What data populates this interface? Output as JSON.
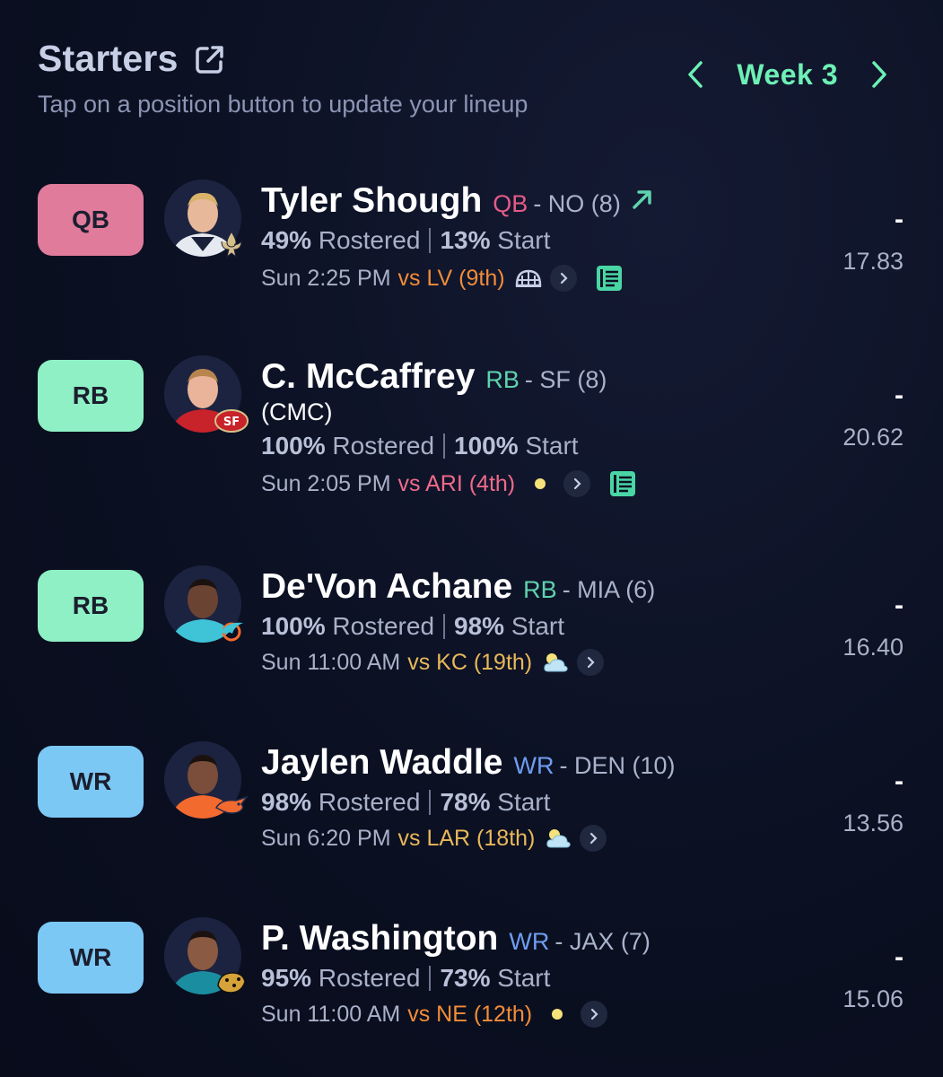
{
  "header": {
    "title": "Starters",
    "subtitle": "Tap on a position button to update your lineup",
    "week_label": "Week 3"
  },
  "colors": {
    "QB": "#e07b9c",
    "RB": "#8ef0c4",
    "WR": "#7cc8f5",
    "pos_text_QB": "#e45b87",
    "pos_text_RB": "#5fd3ad",
    "pos_text_WR": "#6f9df0",
    "accent": "#6df0b5",
    "opp_orange": "#f28c38",
    "opp_pink": "#f06a8a",
    "opp_yellow": "#e8b85a"
  },
  "players": [
    {
      "position": "QB",
      "name": "Tyler Shough",
      "pos_tag": "QB",
      "team": "- NO (8)",
      "trend_icon": "trending-up-icon",
      "nickname": "",
      "rostered_pct": "49%",
      "rostered_label": "Rostered",
      "start_pct": "13%",
      "start_label": "Start",
      "game_time": "Sun 2:25 PM",
      "opponent": "vs LV (9th)",
      "opp_color": "orange",
      "weather_icon": "dome-icon",
      "has_news": true,
      "proj_dash": "-",
      "proj_points": "17.83",
      "team_logo": "saints-logo"
    },
    {
      "position": "RB",
      "name": "C. McCaffrey",
      "pos_tag": "RB",
      "team": "- SF (8)",
      "nickname": "(CMC)",
      "rostered_pct": "100%",
      "rostered_label": "Rostered",
      "start_pct": "100%",
      "start_label": "Start",
      "game_time": "Sun 2:05 PM",
      "opponent": "vs ARI (4th)",
      "opp_color": "pink",
      "weather_icon": "sun-icon",
      "has_news": true,
      "proj_dash": "-",
      "proj_points": "20.62",
      "team_logo": "49ers-logo"
    },
    {
      "position": "RB",
      "name": "De'Von Achane",
      "pos_tag": "RB",
      "team": "- MIA (6)",
      "nickname": "",
      "rostered_pct": "100%",
      "rostered_label": "Rostered",
      "start_pct": "98%",
      "start_label": "Start",
      "game_time": "Sun 11:00 AM",
      "opponent": "vs KC (19th)",
      "opp_color": "yellow",
      "weather_icon": "cloud-sun-icon",
      "has_news": false,
      "proj_dash": "-",
      "proj_points": "16.40",
      "team_logo": "dolphins-logo"
    },
    {
      "position": "WR",
      "name": "Jaylen Waddle",
      "pos_tag": "WR",
      "team": "- DEN (10)",
      "nickname": "",
      "rostered_pct": "98%",
      "rostered_label": "Rostered",
      "start_pct": "78%",
      "start_label": "Start",
      "game_time": "Sun 6:20 PM",
      "opponent": "vs LAR (18th)",
      "opp_color": "yellow",
      "weather_icon": "cloud-sun-icon",
      "has_news": false,
      "proj_dash": "-",
      "proj_points": "13.56",
      "team_logo": "broncos-logo"
    },
    {
      "position": "WR",
      "name": "P. Washington",
      "pos_tag": "WR",
      "team": "- JAX (7)",
      "nickname": "",
      "rostered_pct": "95%",
      "rostered_label": "Rostered",
      "start_pct": "73%",
      "start_label": "Start",
      "game_time": "Sun 11:00 AM",
      "opponent": "vs NE (12th)",
      "opp_color": "orange",
      "weather_icon": "sun-icon",
      "has_news": false,
      "proj_dash": "-",
      "proj_points": "15.06",
      "team_logo": "jaguars-logo"
    }
  ]
}
